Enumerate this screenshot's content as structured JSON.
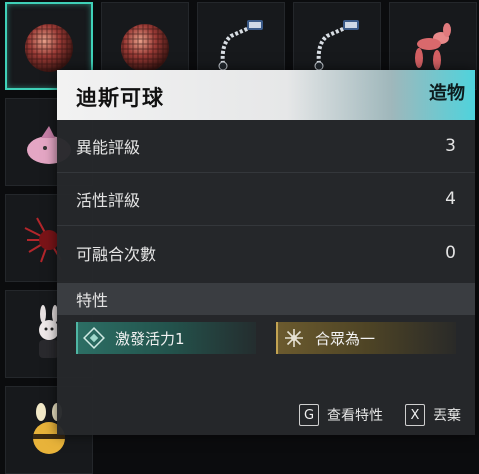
{
  "inventory": {
    "slots": [
      {
        "icon": "disco-ball-icon"
      },
      {
        "icon": "disco-ball-icon"
      },
      {
        "icon": "mechanical-arm-icon"
      },
      {
        "icon": "mechanical-arm-icon"
      },
      {
        "icon": "balloon-dog-icon"
      },
      {
        "icon": "pink-blob-creature-icon"
      },
      {
        "icon": "red-spiky-creature-icon"
      },
      {
        "icon": "bunny-doll-icon"
      },
      {
        "icon": "bee-plush-icon"
      }
    ],
    "selected_index": 0
  },
  "tooltip": {
    "name": "迪斯可球",
    "category": "造物",
    "stats": [
      {
        "label": "異能評級",
        "value": "3"
      },
      {
        "label": "活性評級",
        "value": "4"
      },
      {
        "label": "可融合次數",
        "value": "0"
      }
    ],
    "traits_title": "特性",
    "traits": [
      {
        "label": "激發活力1",
        "icon": "diamond-rune-icon",
        "color": "#2c6e64"
      },
      {
        "label": "合眾為一",
        "icon": "star-burst-icon",
        "color": "#6b5a2e"
      }
    ],
    "hints": [
      {
        "key": "G",
        "label": "查看特性"
      },
      {
        "key": "X",
        "label": "丟棄"
      }
    ]
  },
  "colors": {
    "accent": "#3fd1b8",
    "header_gradient_end": "#4fd3dc"
  }
}
